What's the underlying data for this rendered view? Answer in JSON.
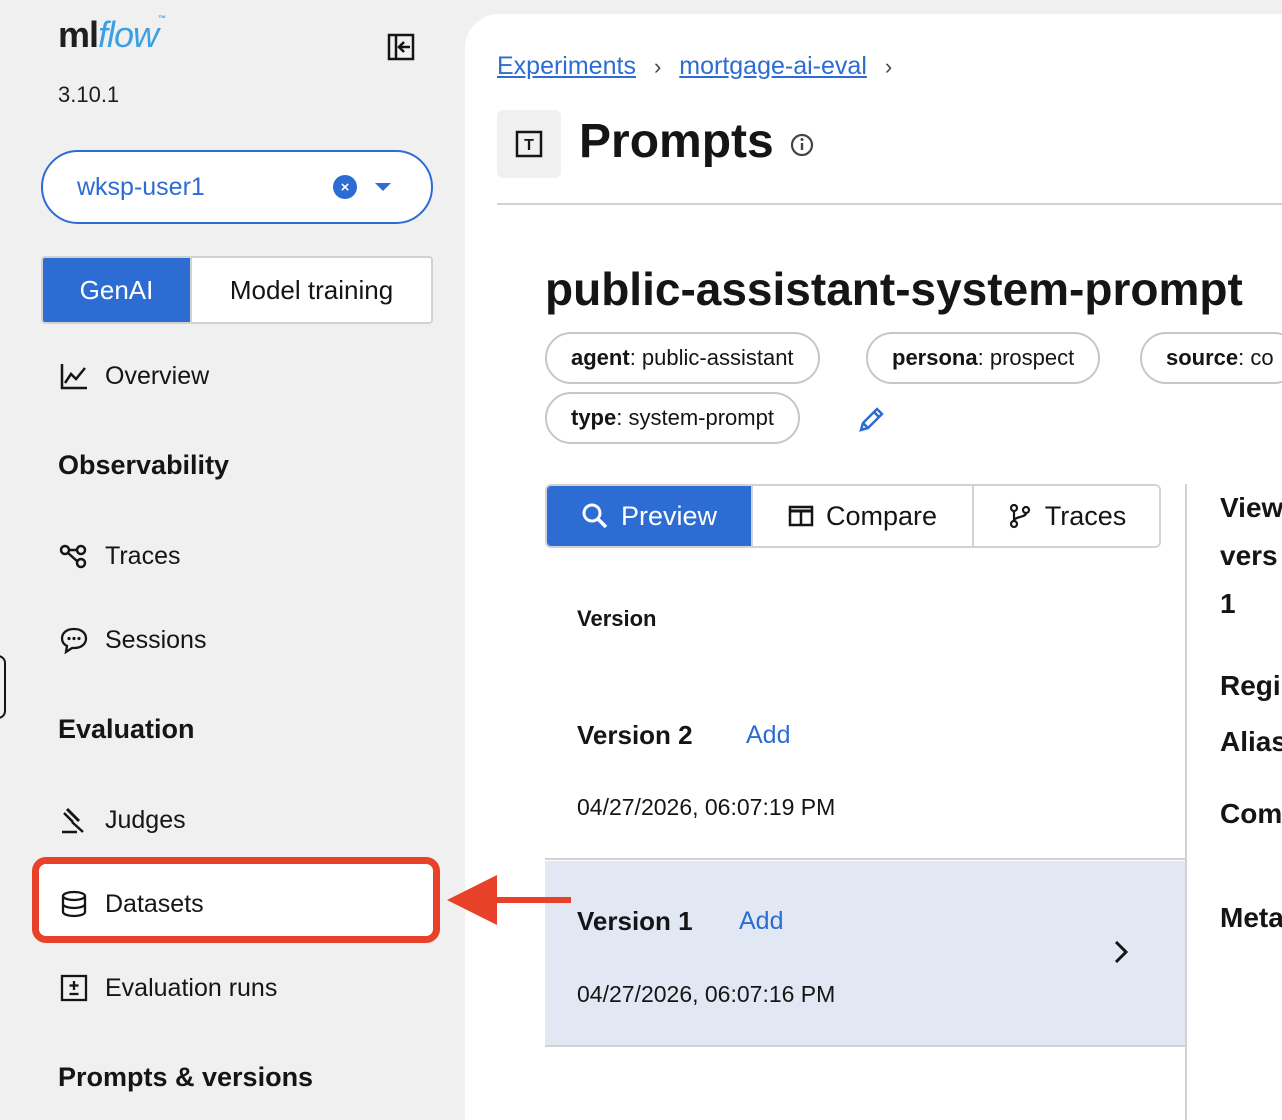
{
  "app": {
    "logo_ml": "ml",
    "logo_flow": "flow",
    "logo_tm": "™",
    "version": "3.10.1"
  },
  "workspace": {
    "value": "wksp-user1",
    "clear_icon": "close-circle-icon",
    "caret_icon": "caret-down-icon"
  },
  "mode_toggle": {
    "genai": "GenAI",
    "model_training": "Model training",
    "active": "GenAI"
  },
  "sidebar": {
    "overview": "Overview",
    "observability_heading": "Observability",
    "traces": "Traces",
    "sessions": "Sessions",
    "evaluation_heading": "Evaluation",
    "judges": "Judges",
    "datasets": "Datasets",
    "evaluation_runs": "Evaluation runs",
    "prompts_heading": "Prompts & versions"
  },
  "breadcrumb": {
    "experiments": "Experiments",
    "experiment_name": "mortgage-ai-eval",
    "separator": "›"
  },
  "page": {
    "title": "Prompts",
    "icon_letter": "T"
  },
  "prompt": {
    "name": "public-assistant-system-prompt",
    "tags": [
      {
        "key": "agent",
        "value": "public-assistant"
      },
      {
        "key": "persona",
        "value": "prospect"
      },
      {
        "key": "source",
        "value": "co"
      },
      {
        "key": "type",
        "value": "system-prompt"
      }
    ]
  },
  "tabs": {
    "preview": "Preview",
    "compare": "Compare",
    "traces": "Traces",
    "active": "Preview"
  },
  "versions": {
    "header": "Version",
    "items": [
      {
        "name": "Version 2",
        "add": "Add",
        "date": "04/27/2026, 06:07:19 PM",
        "selected": false
      },
      {
        "name": "Version 1",
        "add": "Add",
        "date": "04/27/2026, 06:07:16 PM",
        "selected": true
      }
    ]
  },
  "detail_panel": {
    "line1": "View",
    "line2": "vers",
    "line3": "1",
    "registered": "Regi",
    "aliases": "Alias",
    "commit": "Com",
    "metadata": "Meta"
  },
  "colors": {
    "accent": "#2c6cd3",
    "highlight": "#e8412a",
    "selected_row": "#e1e8f3"
  }
}
